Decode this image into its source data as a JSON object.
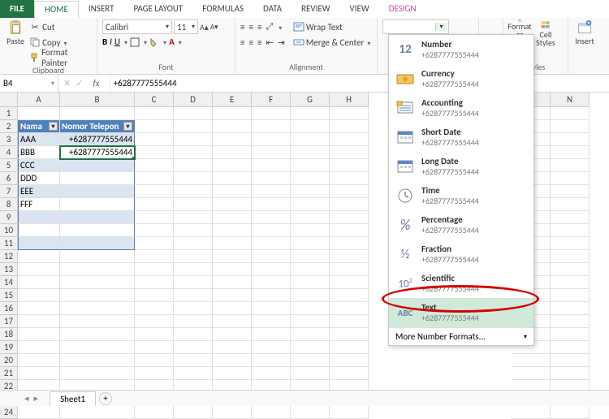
{
  "tabs": {
    "file": "FILE",
    "home": "HOME",
    "insert": "INSERT",
    "page_layout": "PAGE LAYOUT",
    "formulas": "FORMULAS",
    "data": "DATA",
    "review": "REVIEW",
    "view": "VIEW",
    "design": "DESIGN"
  },
  "ribbon": {
    "clipboard": {
      "label": "Clipboard",
      "paste": "Paste",
      "cut": "Cut",
      "copy": "Copy",
      "fp": "Format Painter"
    },
    "font": {
      "label": "Font",
      "name": "Calibri",
      "size": "11"
    },
    "alignment": {
      "label": "Alignment",
      "wrap": "Wrap Text",
      "merge": "Merge & Center"
    },
    "number_input": "",
    "styles": {
      "label": "Styles",
      "fmt_table": "Format as Table",
      "cell_styles": "Cell Styles"
    },
    "cells": {
      "insert": "Insert"
    }
  },
  "formula_bar": {
    "ref": "B4",
    "value": "+6287777555444"
  },
  "columns": [
    "A",
    "B",
    "C",
    "D",
    "E",
    "F",
    "G",
    "H",
    "M",
    "N"
  ],
  "table": {
    "headers": [
      "Nama",
      "Nomor Telepon"
    ],
    "rows": [
      {
        "a": "AAA",
        "b": "+6287777555444"
      },
      {
        "a": "BBB",
        "b": "+6287777555444"
      },
      {
        "a": "CCC",
        "b": ""
      },
      {
        "a": "DDD",
        "b": ""
      },
      {
        "a": "EEE",
        "b": ""
      },
      {
        "a": "FFF",
        "b": ""
      },
      {
        "a": "",
        "b": ""
      },
      {
        "a": "",
        "b": ""
      },
      {
        "a": "",
        "b": ""
      }
    ]
  },
  "selected_cell": {
    "row": 4,
    "col": "B"
  },
  "number_formats": [
    {
      "icon": "12",
      "title": "Number",
      "sample": "+6287777555444"
    },
    {
      "icon": "cur",
      "title": "Currency",
      "sample": "+6287777555444"
    },
    {
      "icon": "acc",
      "title": "Accounting",
      "sample": "+6287777555444"
    },
    {
      "icon": "sdate",
      "title": "Short Date",
      "sample": "+6287777555444"
    },
    {
      "icon": "ldate",
      "title": "Long Date",
      "sample": "+6287777555444"
    },
    {
      "icon": "time",
      "title": "Time",
      "sample": "+6287777555444"
    },
    {
      "icon": "%",
      "title": "Percentage",
      "sample": "+6287777555444"
    },
    {
      "icon": "½",
      "title": "Fraction",
      "sample": "+6287777555444"
    },
    {
      "icon": "10²",
      "title": "Scientific",
      "sample": "+6287777555444"
    },
    {
      "icon": "ABC",
      "title": "Text",
      "sample": "+6287777555444"
    }
  ],
  "number_more": "More Number Formats...",
  "sheet": {
    "name": "Sheet1",
    "add": "+"
  }
}
